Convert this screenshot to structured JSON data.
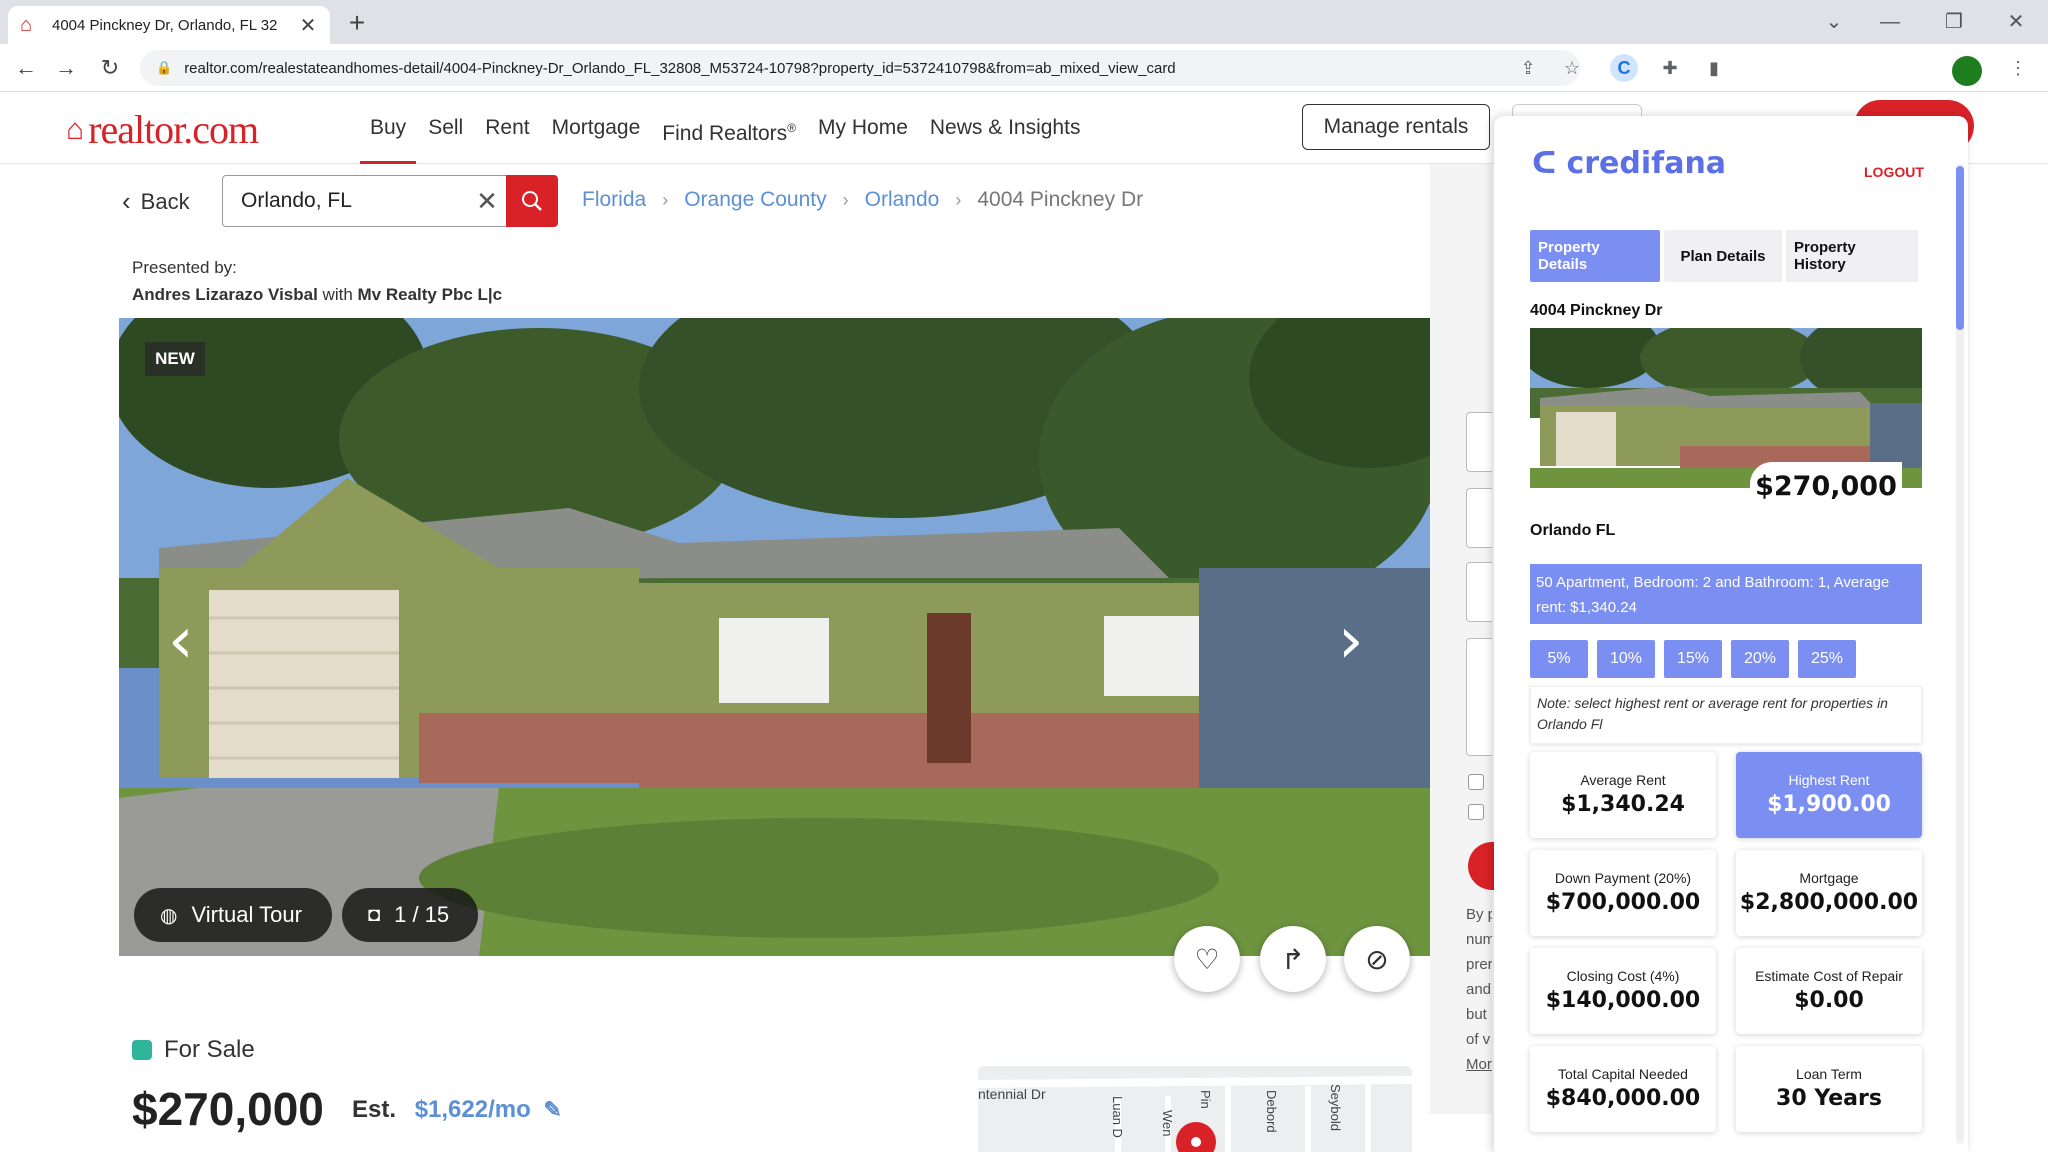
{
  "browser": {
    "tab_title": "4004 Pinckney Dr, Orlando, FL 32",
    "url": "realtor.com/realestateandhomes-detail/4004-Pinckney-Dr_Orlando_FL_32808_M53724-10798?property_id=5372410798&from=ab_mixed_view_card"
  },
  "site": {
    "logo_text": "realtor.com",
    "nav": [
      "Buy",
      "Sell",
      "Rent",
      "Mortgage",
      "Find Realtors",
      "My Home",
      "News & Insights"
    ],
    "nav_reg": "®",
    "manage_rentals": "Manage rentals"
  },
  "search": {
    "back_label": "Back",
    "value": "Orlando, FL"
  },
  "breadcrumb": {
    "state": "Florida",
    "county": "Orange County",
    "city": "Orlando",
    "current": "4004 Pinckney Dr"
  },
  "presented": {
    "label": "Presented by:",
    "agent": "Andres Lizarazo Visbal",
    "with": "with",
    "broker": "Mv Realty Pbc L|c"
  },
  "gallery": {
    "badge": "NEW",
    "virtual_tour": "Virtual Tour",
    "counter": "1 / 15"
  },
  "listing": {
    "status": "For Sale",
    "price": "$270,000",
    "est_label": "Est.",
    "est_monthly": "$1,622/mo"
  },
  "map": {
    "streets": [
      "ntennial Dr",
      "Luan D",
      "Wen",
      "Pin",
      "Debord",
      "Seybold"
    ]
  },
  "contact_text": [
    "By p",
    "num",
    "prer",
    "and",
    "but",
    "of v",
    "Mor"
  ],
  "panel": {
    "brand": "credifana",
    "logout": "LOGOUT",
    "tabs": [
      "Property Details",
      "Plan Details",
      "Property History"
    ],
    "address": "4004 Pinckney Dr",
    "price": "$270,000",
    "city": "Orlando FL",
    "info": "50 Apartment, Bedroom: 2 and Bathroom: 1, Average rent: $1,340.24",
    "percents": [
      "5%",
      "10%",
      "15%",
      "20%",
      "25%"
    ],
    "note": "Note: select highest rent or average rent for properties in Orlando Fl",
    "cards": [
      {
        "label": "Average Rent",
        "value": "$1,340.24"
      },
      {
        "label": "Highest Rent",
        "value": "$1,900.00"
      },
      {
        "label": "Down Payment (20%)",
        "value": "$700,000.00"
      },
      {
        "label": "Mortgage",
        "value": "$2,800,000.00"
      },
      {
        "label": "Closing Cost (4%)",
        "value": "$140,000.00"
      },
      {
        "label": "Estimate Cost of Repair",
        "value": "$0.00"
      },
      {
        "label": "Total Capital Needed",
        "value": "$840,000.00"
      },
      {
        "label": "Loan Term",
        "value": "30 Years"
      }
    ]
  },
  "colors": {
    "brand_red": "#d92228",
    "link_blue": "#5b8fd6",
    "credifana_purple": "#7b8ef2",
    "status_green": "#2fb59a"
  }
}
